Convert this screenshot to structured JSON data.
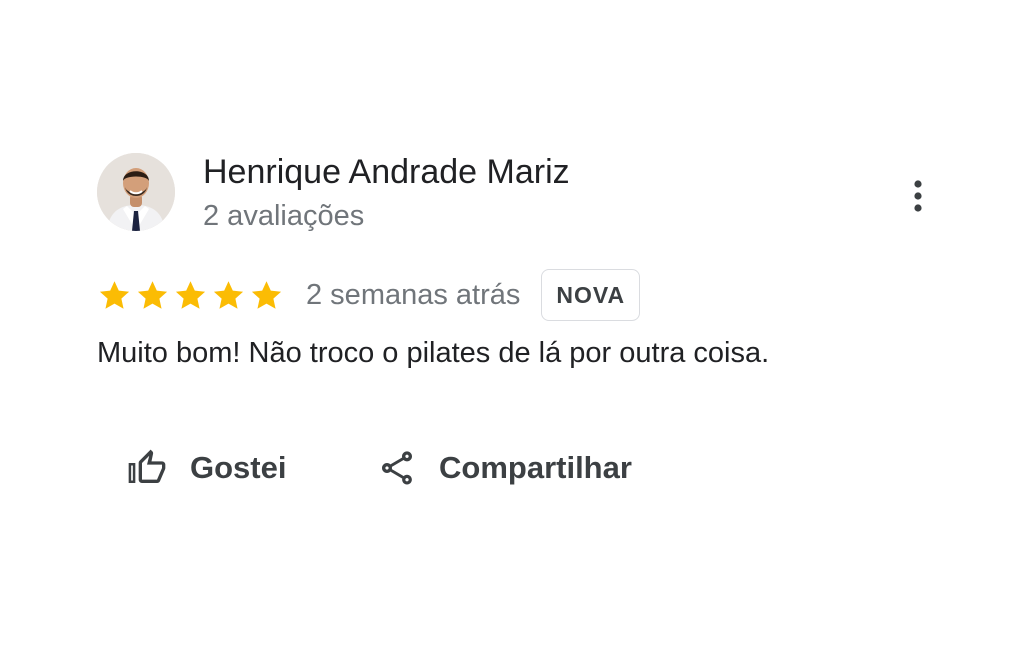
{
  "review": {
    "author_name": "Henrique Andrade Mariz",
    "author_meta": "2 avaliações",
    "rating": 5,
    "rating_max": 5,
    "date": "2 semanas atrás",
    "badge": "NOVA",
    "text": "Muito bom! Não troco o pilates de lá por outra coisa."
  },
  "actions": {
    "like_label": "Gostei",
    "share_label": "Compartilhar"
  },
  "icons": {
    "menu": "more-vert-icon",
    "star": "star-icon",
    "like": "thumb-up-icon",
    "share": "share-icon"
  },
  "colors": {
    "star": "#fbbc04",
    "primary_text": "#202124",
    "secondary_text": "#70757a",
    "action_text": "#3c4043",
    "badge_border": "#dadce0"
  }
}
